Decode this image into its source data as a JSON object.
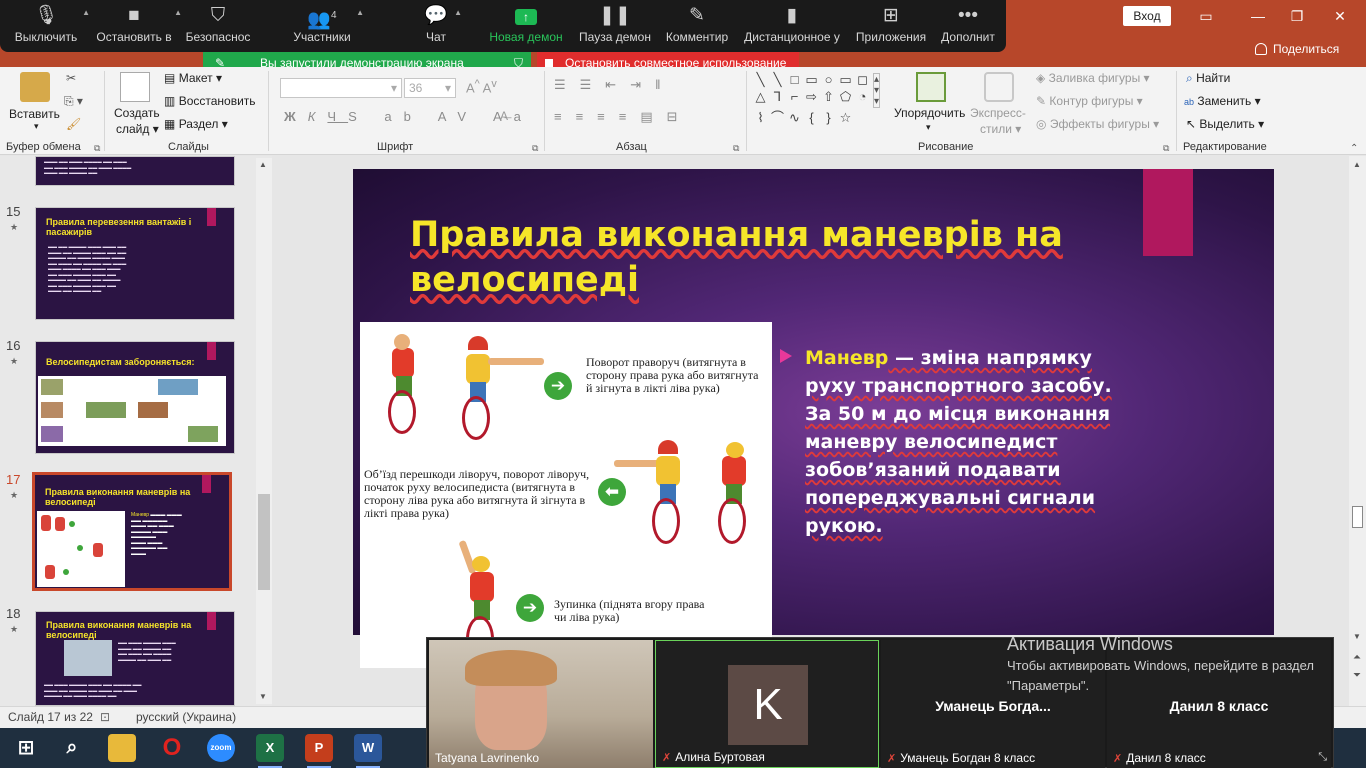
{
  "powerpoint": {
    "enter_label": "Вход",
    "share_label": "Поделиться"
  },
  "zoom_toolbar": {
    "mute": "Выключить",
    "video": "Остановить в",
    "security": "Безопаснос",
    "participants": "Участники",
    "participants_count": "4",
    "chat": "Чат",
    "new_share": "Новая демон",
    "pause_share": "Пауза демон",
    "annotate": "Комментир",
    "remote": "Дистанционное у",
    "apps": "Приложения",
    "more": "Дополнит"
  },
  "banners": {
    "sharing": "Вы запустили демонстрацию экрана",
    "stop": "Остановить совместное использование"
  },
  "ribbon": {
    "paste": "Вставить",
    "new_slide_1": "Создать",
    "new_slide_2": "слайд",
    "layout": "Макет",
    "reset": "Восстановить",
    "section": "Раздел",
    "clipboard_group": "Буфер обмена",
    "slides_group": "Слайды",
    "font_group": "Шрифт",
    "paragraph_group": "Абзац",
    "drawing_group": "Рисование",
    "editing_group": "Редактирование",
    "font_size": "36",
    "arrange": "Упорядочить",
    "quick_styles_1": "Экспресс-",
    "quick_styles_2": "стили",
    "shape_fill": "Заливка фигуры",
    "shape_outline": "Контур фигуры",
    "shape_effects": "Эффекты фигуры",
    "find": "Найти",
    "replace": "Заменить",
    "select": "Выделить"
  },
  "thumbnails": [
    {
      "num": "15",
      "title": "Правила перевезення вантажів і пасажирів"
    },
    {
      "num": "16",
      "title": "Велосипедистам забороняється:"
    },
    {
      "num": "17",
      "title": "Правила виконання маневрів на велосипеді"
    },
    {
      "num": "18",
      "title": "Правила виконання маневрів на велосипеді"
    }
  ],
  "slide": {
    "title": "Правила виконання маневрів на велосипеді",
    "bullet_term": "Маневр",
    "bullet_text": " — зміна напрямку руху транспортного засобу. За 50 м до місця виконання маневру велосипедист зобов’язаний подавати попереджувальні сигнали рукою.",
    "captions": {
      "right_turn": "Поворот праворуч (витягнута в сторону права рука або витягнута й зігнута в лікті ліва рука)",
      "left_turn": "Об’їзд перешкоди ліворуч, поворот ліворуч, початок руху велосипедиста (витягнута в сторону ліва рука або витягнута й зігнута в лікті права рука)",
      "stop": "Зупинка (піднята вгору права чи ліва рука)"
    }
  },
  "status": {
    "slide_info": "Слайд 17 из 22",
    "language": "русский (Украина)"
  },
  "gallery": {
    "p1": "Tatyana Lavrinenko",
    "p2_initial": "K",
    "p2": "Алина Буртовая",
    "p3_big": "Уманець  Богда...",
    "p3": "Уманець Богдан 8 класс",
    "p4_big": "Данил 8 класс",
    "p4": "Данил 8 класс"
  },
  "activation": {
    "title": "Активация Windows",
    "subtitle": "Чтобы активировать Windows, перейдите в раздел \"Параметры\"."
  },
  "colors": {
    "accent_orange": "#b7472a",
    "slide_title": "#f6e629",
    "slide_accent_bar": "#b0185e",
    "zoom_green": "#20a84b",
    "zoom_red": "#e02d2d"
  }
}
